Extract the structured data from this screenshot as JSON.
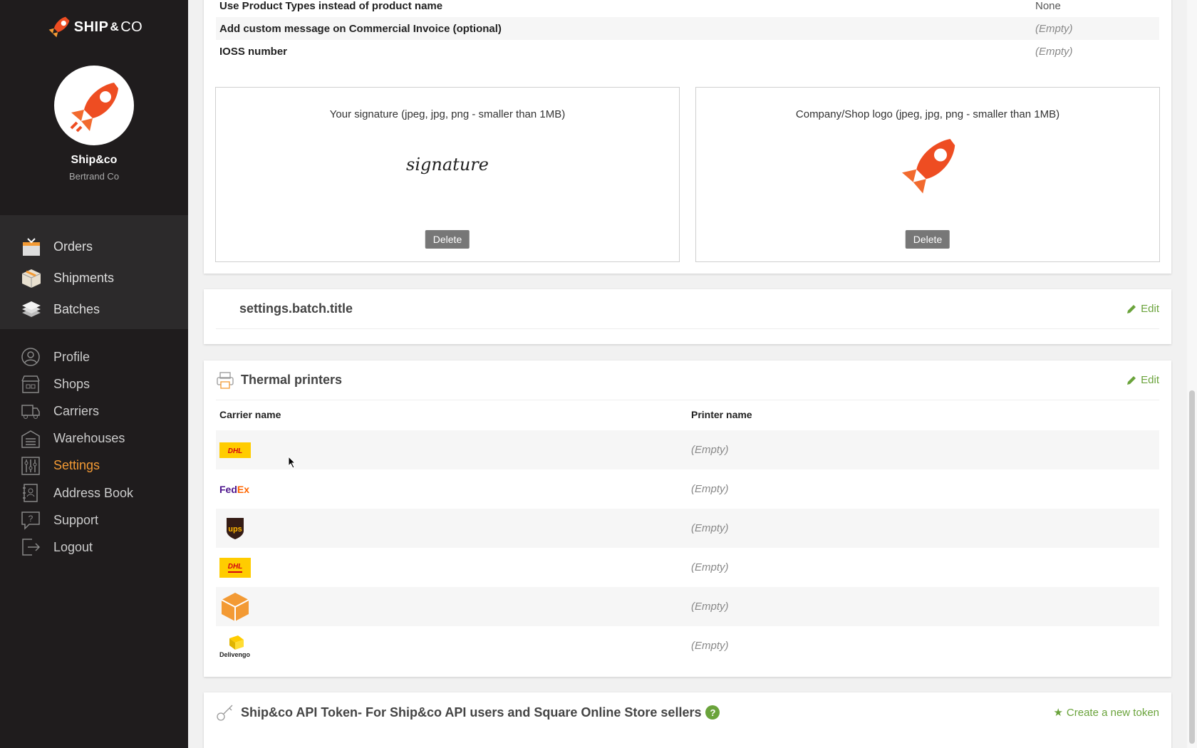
{
  "brand": {
    "logo_main": "SHIP",
    "logo_amp": "&",
    "logo_co": "CO"
  },
  "account": {
    "name": "Ship&co",
    "company": "Bertrand Co"
  },
  "main_nav": [
    {
      "label": "Orders",
      "icon": "orders-box-icon"
    },
    {
      "label": "Shipments",
      "icon": "shipment-box-icon"
    },
    {
      "label": "Batches",
      "icon": "batches-stack-icon"
    }
  ],
  "secondary_nav": [
    {
      "label": "Profile",
      "icon": "profile-icon"
    },
    {
      "label": "Shops",
      "icon": "shop-icon"
    },
    {
      "label": "Carriers",
      "icon": "truck-icon"
    },
    {
      "label": "Warehouses",
      "icon": "warehouse-icon"
    },
    {
      "label": "Settings",
      "icon": "settings-sliders-icon",
      "active": true
    },
    {
      "label": "Address Book",
      "icon": "address-book-icon"
    },
    {
      "label": "Support",
      "icon": "support-icon"
    },
    {
      "label": "Logout",
      "icon": "logout-icon"
    }
  ],
  "invoice_settings": {
    "rows": [
      {
        "label": "Use Product Types instead of product name",
        "value": "None"
      },
      {
        "label": "Add custom message on Commercial Invoice (optional)",
        "value": "(Empty)"
      },
      {
        "label": "IOSS number",
        "value": "(Empty)"
      }
    ],
    "signature": {
      "title": "Your signature (jpeg, jpg, png - smaller than 1MB)",
      "preview_text": "signature",
      "delete_label": "Delete"
    },
    "logo": {
      "title": "Company/Shop logo (jpeg, jpg, png - smaller than 1MB)",
      "delete_label": "Delete"
    }
  },
  "batch": {
    "title": "settings.batch.title",
    "edit_label": "Edit"
  },
  "thermal_printers": {
    "title": "Thermal printers",
    "edit_label": "Edit",
    "col_carrier": "Carrier name",
    "col_printer": "Printer name",
    "rows": [
      {
        "carrier": "DHL",
        "printer": "(Empty)"
      },
      {
        "carrier": "FedEx",
        "printer": "(Empty)"
      },
      {
        "carrier": "UPS",
        "printer": "(Empty)"
      },
      {
        "carrier": "DHL eCommerce",
        "printer": "(Empty)"
      },
      {
        "carrier": "Custom",
        "printer": "(Empty)"
      },
      {
        "carrier": "Delivengo",
        "printer": "(Empty)"
      }
    ],
    "logo_text": {
      "fedex_fed": "Fed",
      "fedex_ex": "Ex",
      "ups": "ups",
      "delivengo": "Delivengo",
      "dhl": "DHL"
    }
  },
  "api_token": {
    "title": "Ship&co API Token- For Ship&co API users and Square Online Store sellers",
    "help": "?",
    "create_label": "Create a new token"
  },
  "colors": {
    "accent": "#f39a34",
    "sidebar_bg": "#1f1c1d",
    "link_green": "#6aa33b",
    "rocket": "#ee4d22"
  }
}
